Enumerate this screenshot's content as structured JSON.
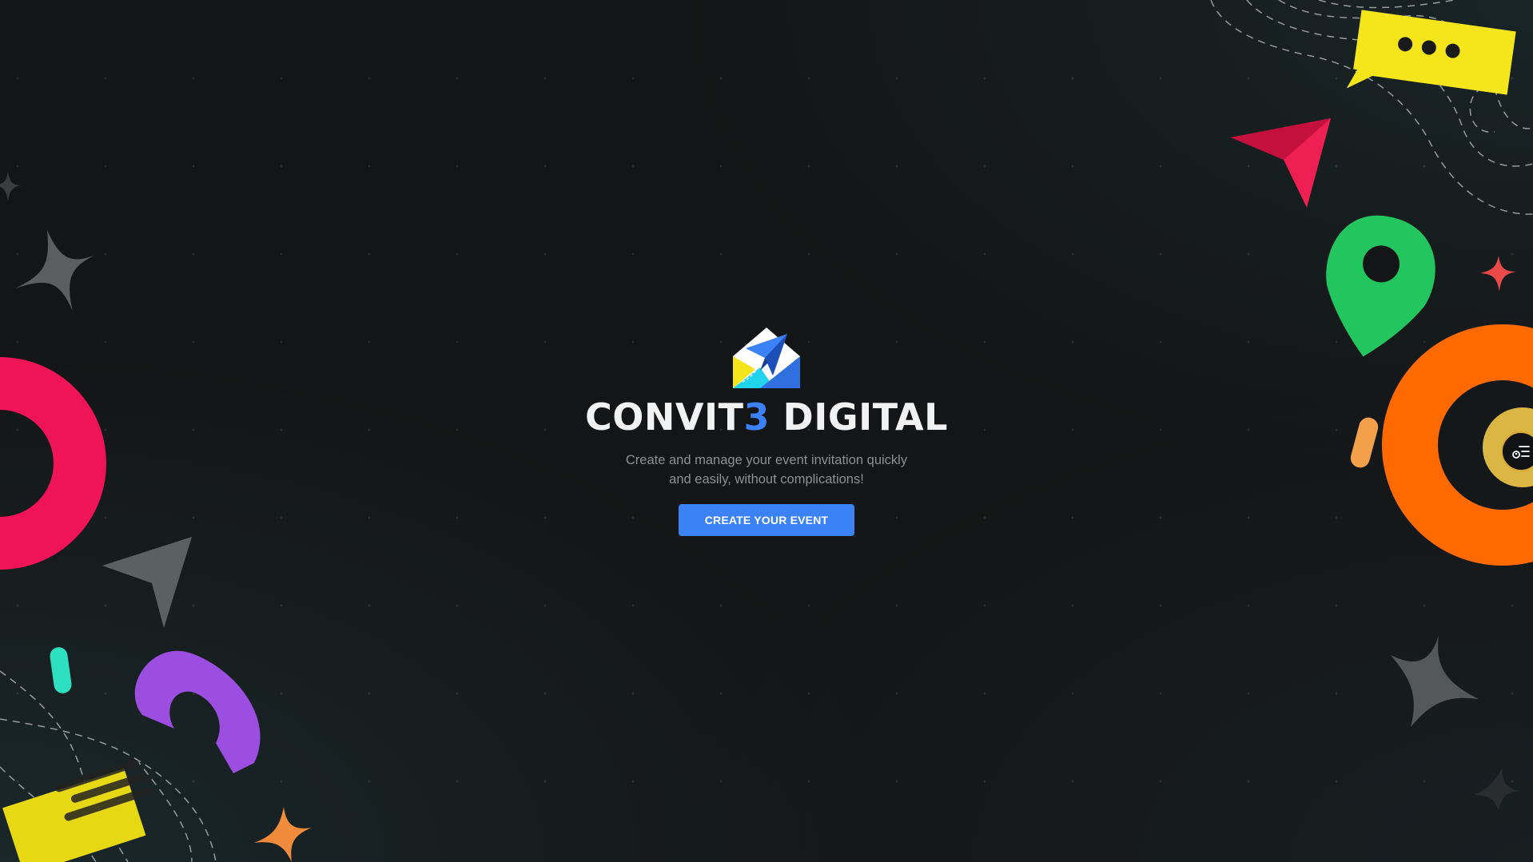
{
  "brand": {
    "name_main": "CONVIT",
    "name_accent": "3",
    "name_rest": " DIGITAL",
    "logo_icon": "envelope-paper-plane-icon"
  },
  "hero": {
    "tagline": "Create and manage your event invitation quickly and easily, without complications!",
    "cta_label": "CREATE YOUR EVENT"
  },
  "floating_button": {
    "icon": "user-list-icon"
  },
  "colors": {
    "background": "#141516",
    "accent": "#3b82f6",
    "pink": "#ef1458",
    "orange": "#ff6a00",
    "green": "#22c55e",
    "yellow": "#f5e61b",
    "purple": "#9b4ee0",
    "teal": "#2de0c0"
  }
}
